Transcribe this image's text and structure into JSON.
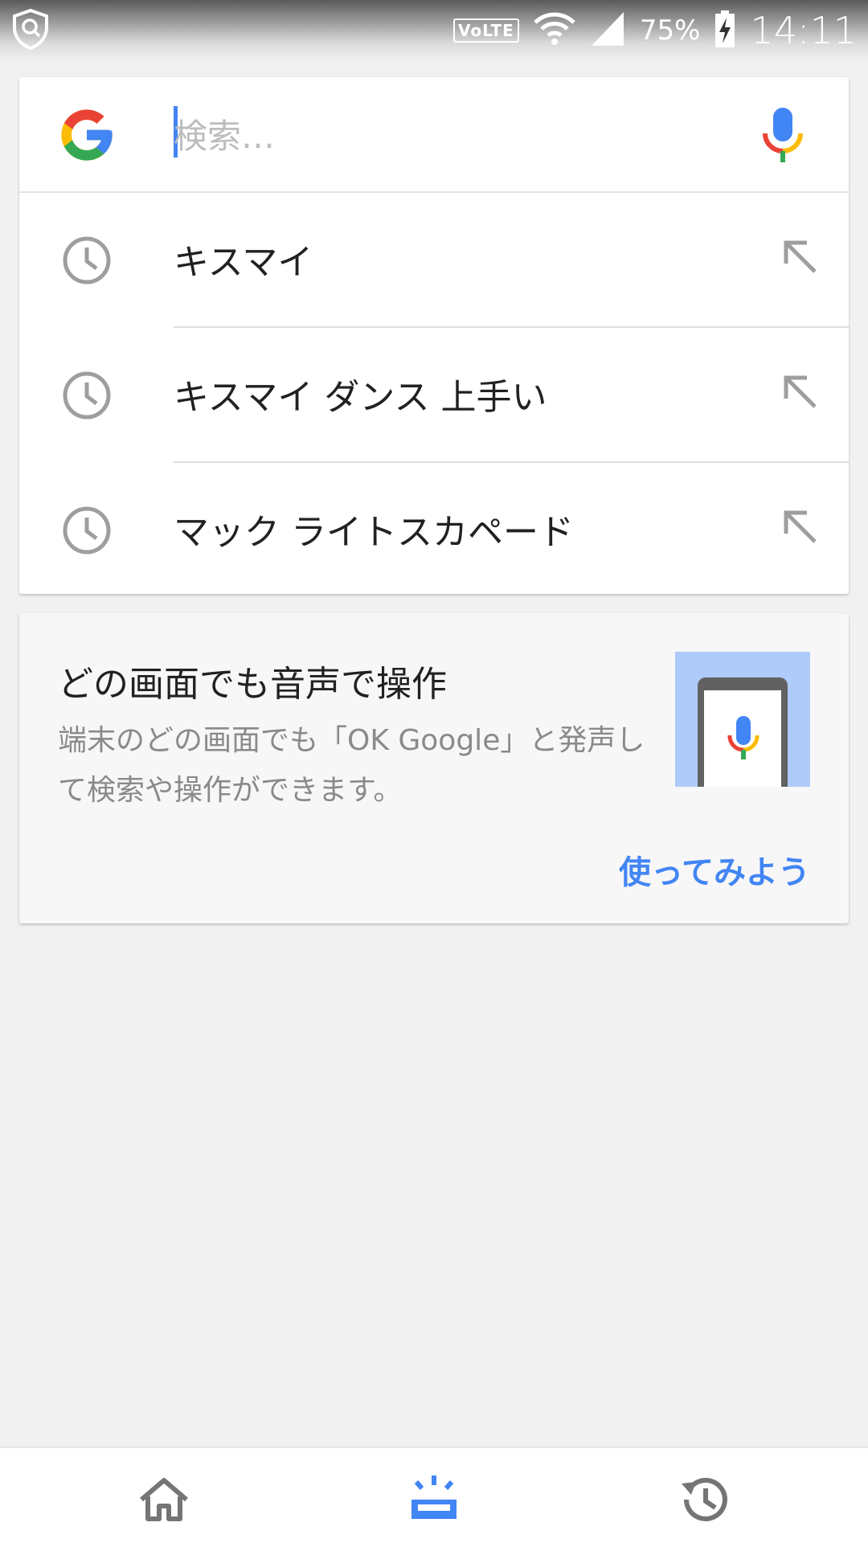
{
  "status_bar": {
    "left_icon": "shield-icon",
    "network_label": "VoLTE",
    "battery_percent": "75%",
    "time": "14:11",
    "icons": [
      "wifi-icon",
      "signal-icon",
      "battery-charging-icon"
    ]
  },
  "search": {
    "placeholder": "検索…",
    "value": "",
    "logo": "google-g-logo",
    "mic_icon": "mic-icon"
  },
  "suggestions": [
    {
      "text": "キスマイ",
      "icon": "history-clock-icon",
      "action_icon": "arrow-up-left-icon"
    },
    {
      "text": "キスマイ ダンス 上手い",
      "icon": "history-clock-icon",
      "action_icon": "arrow-up-left-icon"
    },
    {
      "text": "マック ライトスカペード",
      "icon": "history-clock-icon",
      "action_icon": "arrow-up-left-icon"
    }
  ],
  "promo": {
    "title": "どの画面でも音声で操作",
    "body": "端末のどの画面でも「OK Google」と発声して検索や操作ができます。",
    "action_label": "使ってみよう",
    "image_icon": "phone-mic-icon"
  },
  "bottom_nav": {
    "items": [
      {
        "name": "home",
        "icon": "home-icon",
        "active": false
      },
      {
        "name": "upcoming",
        "icon": "upcoming-icon",
        "active": true
      },
      {
        "name": "recent",
        "icon": "history-icon",
        "active": false
      }
    ]
  },
  "colors": {
    "accent": "#4285f4",
    "google_red": "#ea4335",
    "google_yellow": "#fbbc05",
    "google_green": "#34a853",
    "icon_gray": "#9e9e9e",
    "background": "#f1f1f1"
  }
}
